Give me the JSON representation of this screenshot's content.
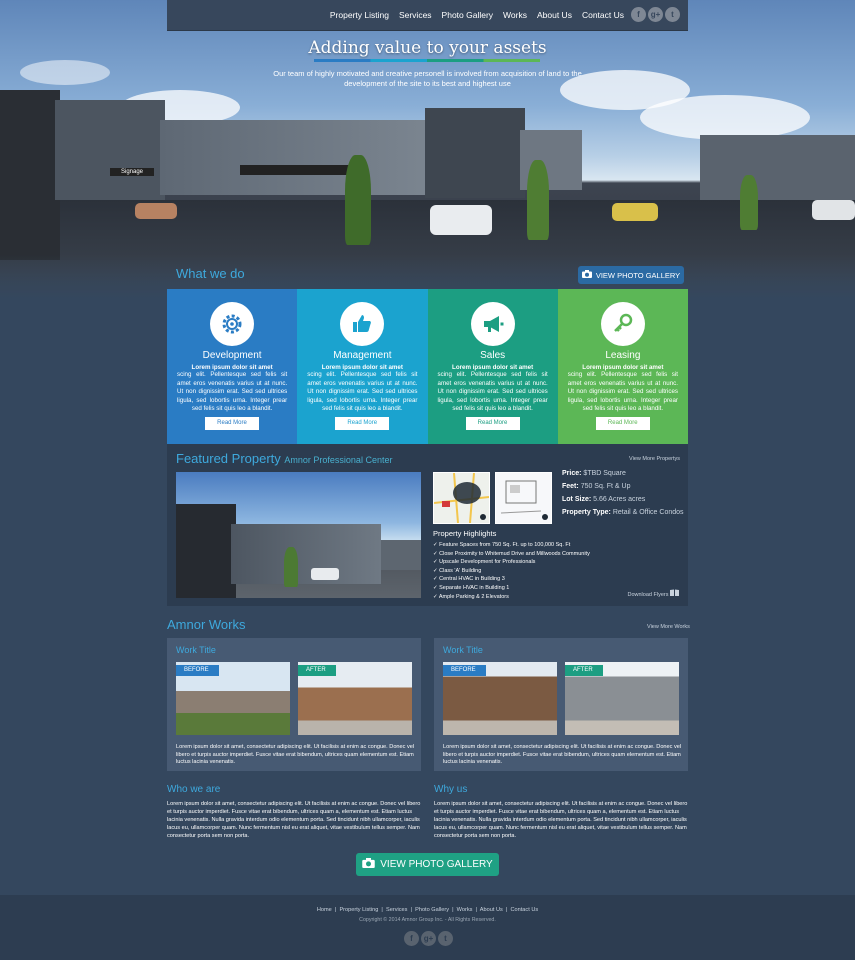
{
  "nav": {
    "links": [
      "Property Listing",
      "Services",
      "Photo Gallery",
      "Works",
      "About Us",
      "Contact Us"
    ],
    "social": [
      "f",
      "g+",
      "t"
    ]
  },
  "hero": {
    "title": "Adding value to your assets",
    "subtitle": "Our team of highly motivated and creative personell is involved from acquisition of land to the development of the site to its best and highest use",
    "signage": "Signage"
  },
  "what_we_do": {
    "title": "What we do",
    "gallery_button": "VIEW PHOTO GALLERY",
    "services": [
      {
        "name": "Development",
        "icon": "gear-icon",
        "color": "#2a7cc4",
        "bold": "Lorem ipsum dolor sit amet",
        "body": "scing elit. Pellentesque sed felis sit amet eros venenatis varius ut at nunc. Ut non dignissim erat. Sed sed ultrices ligula, sed lobortis urna. Integer prear sed felis sit quis leo a blandit.",
        "button": "Read More"
      },
      {
        "name": "Management",
        "icon": "thumbs-up-icon",
        "color": "#1ba3cf",
        "bold": "Lorem ipsum dolor sit amet",
        "body": "scing elit. Pellentesque sed felis sit amet eros venenatis varius ut at nunc. Ut non dignissim erat. Sed sed ultrices ligula, sed lobortis urna. Integer prear sed felis sit quis leo a blandit.",
        "button": "Read More"
      },
      {
        "name": "Sales",
        "icon": "megaphone-icon",
        "color": "#1c9e82",
        "bold": "Lorem ipsum dolor sit amet",
        "body": "scing elit. Pellentesque sed felis sit amet eros venenatis varius ut at nunc. Ut non dignissim erat. Sed sed ultrices ligula, sed lobortis urna. Integer prear sed felis sit quis leo a blandit.",
        "button": "Read More"
      },
      {
        "name": "Leasing",
        "icon": "key-icon",
        "color": "#5cb756",
        "bold": "Lorem ipsum dolor sit amet",
        "body": "scing elit. Pellentesque sed felis sit amet eros venenatis varius ut at nunc. Ut non dignissim erat. Sed sed ultrices ligula, sed lobortis urna. Integer prear sed felis sit quis leo a blandit.",
        "button": "Read More"
      }
    ]
  },
  "featured": {
    "title": "Featured Property",
    "subtitle": "Amnor Professional Center",
    "more": "View More Propertys",
    "specs": [
      {
        "label": "Price:",
        "value": "$TBD Square"
      },
      {
        "label": "Feet:",
        "value": "750 Sq. Ft & Up"
      },
      {
        "label": "Lot Size:",
        "value": "5.66 Acres acres"
      },
      {
        "label": "Property Type:",
        "value": "Retail & Office Condos"
      }
    ],
    "highlights_title": "Property Highlights",
    "highlights": [
      "Feature Spaces from 750 Sq. Ft. up to 100,000 Sq. Ft",
      "Close Proximity to Whitemud Drive and Millwoods Community",
      "Upscale Development for Professionals",
      "Class 'A' Building",
      "Central HVAC in Building 3",
      "Separate HVAC in Building 1",
      "Ample Parking & 2 Elevators"
    ],
    "download": "Download Flyers"
  },
  "works": {
    "title": "Amnor Works",
    "more": "View More Works",
    "items": [
      {
        "title": "Work Title",
        "before": "BEFORE",
        "after": "AFTER",
        "text": "Lorem ipsum dolor sit amet, consectetur adipiscing elit. Ut facilisis at enim ac congue. Donec vel libero et turpis auctor imperdiet. Fusce vitae erat bibendum, ultrices quam elementum est. Etiam luctus lacinia venenatis."
      },
      {
        "title": "Work Title",
        "before": "BEFORE",
        "after": "AFTER",
        "text": "Lorem ipsum dolor sit amet, consectetur adipiscing elit. Ut facilisis at enim ac congue. Donec vel libero et turpis auctor imperdiet. Fusce vitae erat bibendum, ultrices quam elementum est. Etiam luctus lacinia venenatis."
      }
    ]
  },
  "who": {
    "title": "Who we are",
    "text": "Lorem ipsum dolor sit amet, consectetur adipiscing elit. Ut facilisis at enim ac congue. Donec vel libero et turpis auctor imperdiet. Fusce vitae erat bibendum, ultrices quam a, elementum est. Etiam luctus lacinia venenatis. Nulla gravida interdum odio elementum porta. Sed tincidunt nibh ullamcorper, iaculis lacus eu, ullamcorper quam. Nunc fermentum nisl eu erat aliquet, vitae vestibulum tellus semper. Nam consectetur porta sem non porta."
  },
  "why": {
    "title": "Why us",
    "text": "Lorem ipsum dolor sit amet, consectetur adipiscing elit. Ut facilisis at enim ac congue. Donec vel libero et turpis auctor imperdiet. Fusce vitae erat bibendum, ultrices quam a, elementum est. Etiam luctus lacinia venenatis. Nulla gravida interdum odio elementum porta. Sed tincidunt nibh ullamcorper, iaculis lacus eu, ullamcorper quam. Nunc fermentum nisl eu erat aliquet, vitae vestibulum tellus semper. Nam consectetur porta sem non porta."
  },
  "gallery_button_large": "VIEW PHOTO GALLERY",
  "footer": {
    "links": [
      "Home",
      "Property Listing",
      "Services",
      "Photo Gallery",
      "Works",
      "About Us",
      "Contact Us"
    ],
    "copyright": "Copyright © 2014 Amnor Group Inc. - All Rights Reserved.",
    "social": [
      "f",
      "g+",
      "t"
    ]
  }
}
